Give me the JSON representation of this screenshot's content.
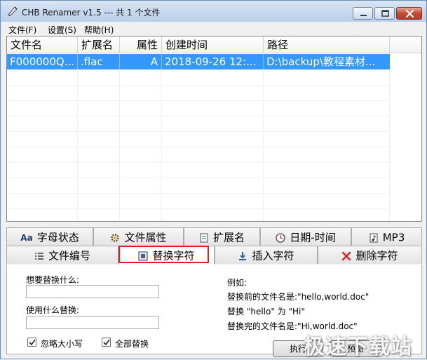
{
  "window": {
    "title": "CHB Renamer v1.5 --- 共 1 个文件"
  },
  "menu": [
    "文件(F)",
    "设置(S)",
    "帮助(H)"
  ],
  "list": {
    "columns": [
      "文件名",
      "扩展名",
      "属性",
      "创建时间",
      "路径"
    ],
    "rows": [
      {
        "name": "F000000Q...",
        "ext": ".flac",
        "attr": "A",
        "created": "2018-09-26 12:...",
        "path": "D:\\backup\\教程素材..."
      }
    ]
  },
  "tabs_top": [
    {
      "label": "字母状态",
      "icon": "aa-icon",
      "glyph": "Aa"
    },
    {
      "label": "文件属性",
      "icon": "gear-icon"
    },
    {
      "label": "扩展名",
      "icon": "extension-icon"
    },
    {
      "label": "日期-时间",
      "icon": "clock-icon"
    },
    {
      "label": "MP3",
      "icon": "music-file-icon"
    }
  ],
  "tabs_bottom": [
    {
      "label": "文件编号",
      "icon": "numbered-list-icon"
    },
    {
      "label": "替换字符",
      "icon": "replace-icon",
      "active": true
    },
    {
      "label": "插入字符",
      "icon": "insert-icon"
    },
    {
      "label": "删除字符",
      "icon": "delete-icon"
    }
  ],
  "replace_panel": {
    "find_label": "想要替换什么:",
    "find_value": "",
    "replace_label": "使用什么替换:",
    "replace_value": "",
    "ignore_case_label": "忽略大小写",
    "ignore_case_checked": true,
    "replace_all_label": "全部替换",
    "replace_all_checked": true,
    "example_title": "例如:",
    "example_before": "替换前的文件名是:\"hello,world.doc\"",
    "example_rule": "替换 \"hello\" 为 \"Hi\"",
    "example_after": "替换完的文件名是:\"Hi,world.doc\"",
    "execute_label": "执行",
    "preview_label": "预览"
  },
  "watermark": "极速下载站",
  "colors": {
    "selection": "#3399ff",
    "highlight_box": "#e02020",
    "title_gradient": "#c6d8ee"
  }
}
